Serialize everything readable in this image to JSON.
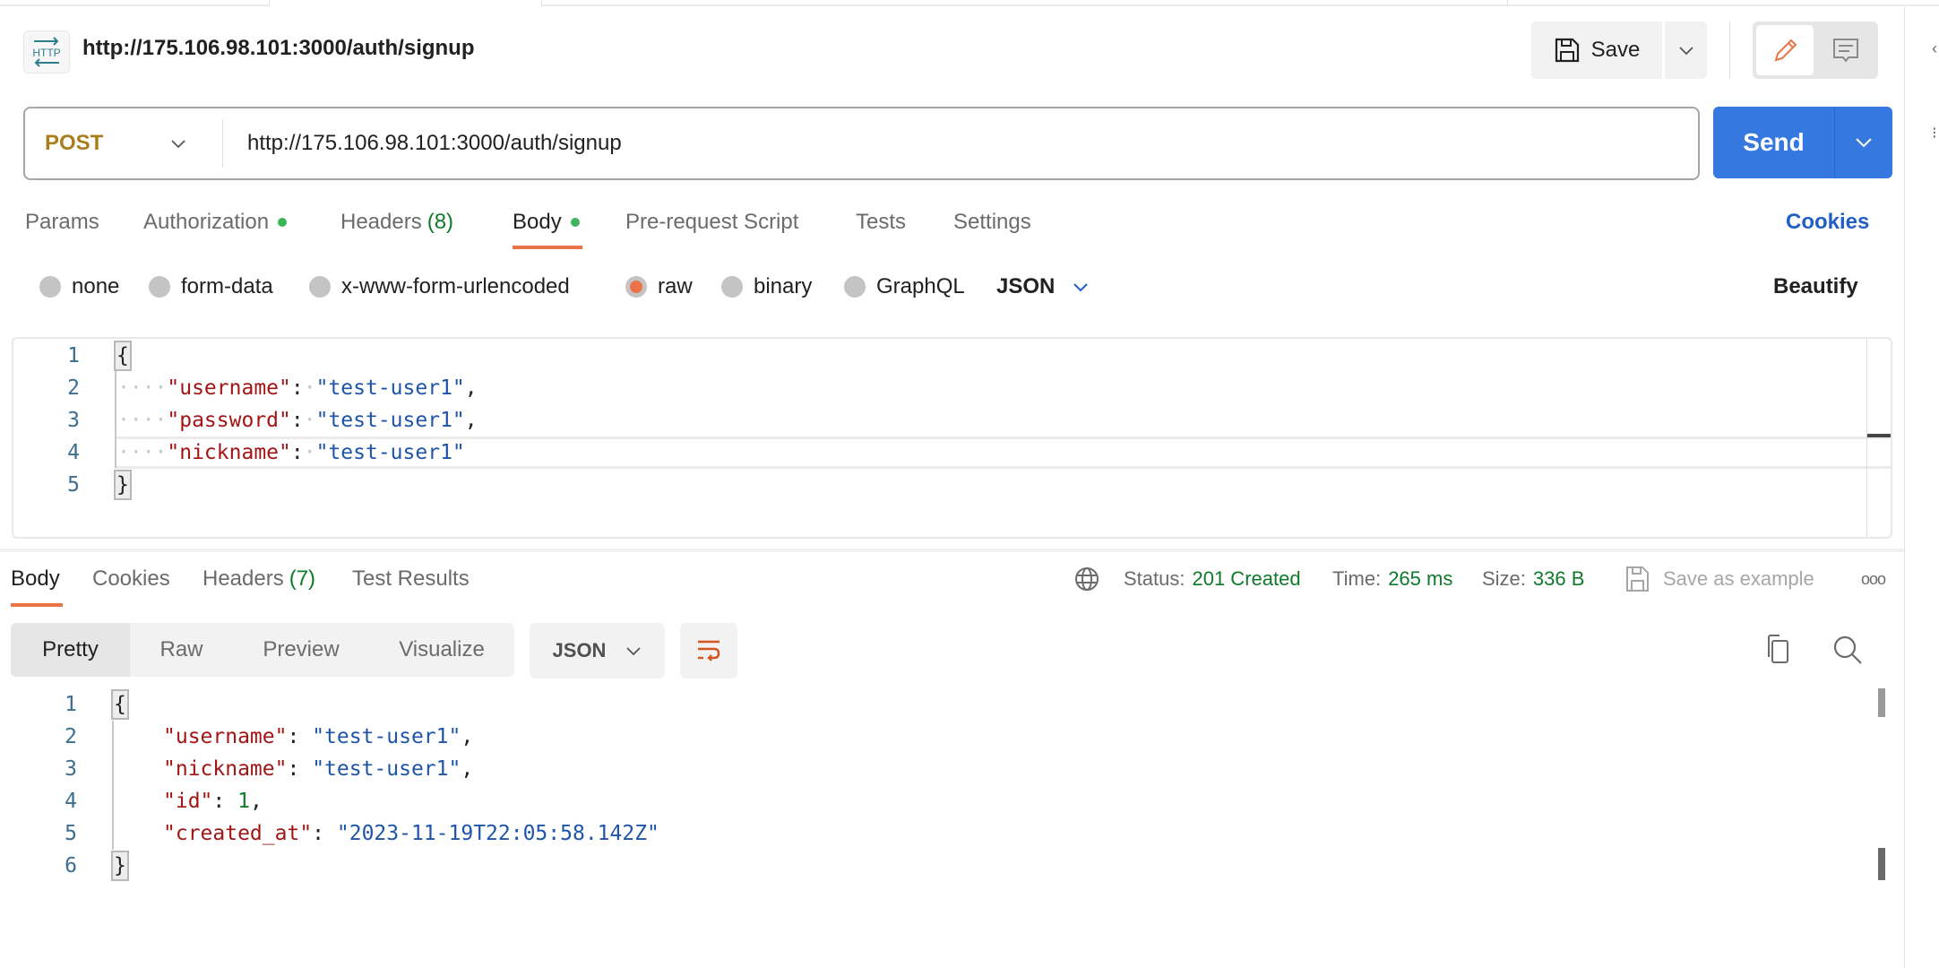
{
  "header": {
    "icon": "http-request-icon",
    "icon_label": "HTTP",
    "title": "http://175.106.98.101:3000/auth/signup",
    "save_label": "Save"
  },
  "request": {
    "method": "POST",
    "url": "http://175.106.98.101:3000/auth/signup",
    "send_label": "Send"
  },
  "request_tabs": [
    {
      "label": "Params"
    },
    {
      "label": "Authorization",
      "dot": true
    },
    {
      "label": "Headers",
      "count": "(8)"
    },
    {
      "label": "Body",
      "dot": true,
      "active": true
    },
    {
      "label": "Pre-request Script"
    },
    {
      "label": "Tests"
    },
    {
      "label": "Settings"
    }
  ],
  "cookies_label": "Cookies",
  "body_modes": [
    {
      "label": "none"
    },
    {
      "label": "form-data"
    },
    {
      "label": "x-www-form-urlencoded"
    },
    {
      "label": "raw",
      "selected": true
    },
    {
      "label": "binary"
    },
    {
      "label": "GraphQL"
    }
  ],
  "body_language": "JSON",
  "beautify_label": "Beautify",
  "request_body": {
    "line_numbers": [
      "1",
      "2",
      "3",
      "4",
      "5"
    ],
    "open": "{",
    "close": "}",
    "fields": [
      {
        "key": "\"username\"",
        "value": "\"test-user1\"",
        "trail": ","
      },
      {
        "key": "\"password\"",
        "value": "\"test-user1\"",
        "trail": ","
      },
      {
        "key": "\"nickname\"",
        "value": "\"test-user1\"",
        "trail": ""
      }
    ]
  },
  "response_tabs": [
    {
      "label": "Body",
      "active": true
    },
    {
      "label": "Cookies"
    },
    {
      "label": "Headers",
      "count": "(7)"
    },
    {
      "label": "Test Results"
    }
  ],
  "response_meta": {
    "status_label": "Status:",
    "status_value": "201 Created",
    "time_label": "Time:",
    "time_value": "265 ms",
    "size_label": "Size:",
    "size_value": "336 B",
    "save_example_label": "Save as example"
  },
  "response_views": [
    "Pretty",
    "Raw",
    "Preview",
    "Visualize"
  ],
  "response_format": "JSON",
  "response_body": {
    "line_numbers": [
      "1",
      "2",
      "3",
      "4",
      "5",
      "6"
    ],
    "open": "{",
    "close": "}",
    "fields": [
      {
        "key": "\"username\"",
        "value": "\"test-user1\"",
        "type": "string",
        "trail": ","
      },
      {
        "key": "\"nickname\"",
        "value": "\"test-user1\"",
        "type": "string",
        "trail": ","
      },
      {
        "key": "\"id\"",
        "value": "1",
        "type": "number",
        "trail": ","
      },
      {
        "key": "\"created_at\"",
        "value": "\"2023-11-19T22:05:58.142Z\"",
        "type": "string",
        "trail": ""
      }
    ]
  },
  "colors": {
    "accent": "#ea7448",
    "send_blue": "#3478e0",
    "link_blue": "#1f5fc6",
    "method_post": "#a97f1e",
    "success_green": "#0f7a2a",
    "dot_green": "#3cb55a"
  }
}
